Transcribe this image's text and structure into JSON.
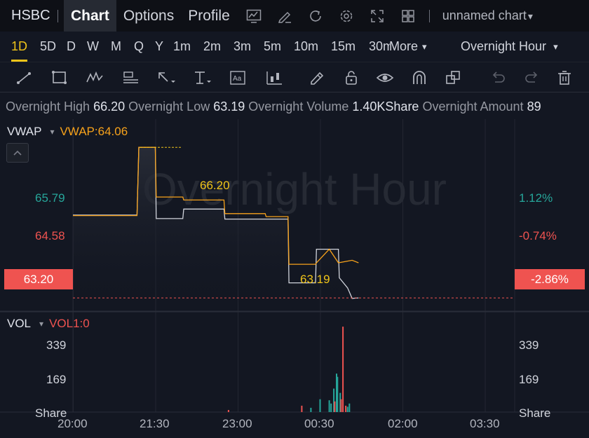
{
  "header": {
    "symbol": "HSBC",
    "tabs": [
      {
        "label": "Chart",
        "active": true
      },
      {
        "label": "Options",
        "active": false
      },
      {
        "label": "Profile",
        "active": false
      }
    ],
    "icons": [
      "chart-type-icon",
      "draw-pencil-icon",
      "refresh-icon",
      "settings-gear-icon",
      "fullscreen-icon",
      "layout-grid-icon"
    ],
    "chart_name": "unnamed chart",
    "chart_name_caret": "▾"
  },
  "timeframes": {
    "items": [
      "1D",
      "5D",
      "D",
      "W",
      "M",
      "Q",
      "Y",
      "1m",
      "2m",
      "3m",
      "5m",
      "10m",
      "15m",
      "30m"
    ],
    "more": "More",
    "more_caret": "▾",
    "active": "1D",
    "session": "Overnight Hour",
    "session_caret": "▾"
  },
  "tools": [
    "trend-line-icon",
    "rectangle-icon",
    "pattern-icon",
    "text-note-icon",
    "arrow-icon",
    "price-range-icon",
    "text-label-icon",
    "candles-icon",
    "brush-icon",
    "lock-icon",
    "eye-icon",
    "magnet-icon",
    "clone-icon",
    "undo-icon",
    "redo-icon",
    "trash-icon"
  ],
  "info": {
    "high_label": "Overnight High",
    "high_value": "66.20",
    "low_label": "Overnight Low",
    "low_value": "63.19",
    "volume_label": "Overnight Volume",
    "volume_value": "1.40KShare",
    "amount_label": "Overnight Amount",
    "amount_value": "89"
  },
  "price_pane": {
    "indicator_name": "VWAP",
    "indicator_caret": "▾",
    "indicator_value": "VWAP:64.06",
    "watermark": "Overnight Hour",
    "left_axis": [
      "65.79",
      "64.58"
    ],
    "right_axis": [
      "1.12%",
      "-0.74%"
    ],
    "current_price": "63.20",
    "current_pct": "-2.86%",
    "high_marker": "66.20",
    "low_marker": "63.19"
  },
  "volume_pane": {
    "indicator_name": "VOL",
    "indicator_caret": "▾",
    "indicator_value": "VOL1:0",
    "left_axis": [
      "339",
      "169",
      "Share"
    ],
    "right_axis": [
      "339",
      "169",
      "Share"
    ]
  },
  "time_axis": [
    "20:00",
    "21:30",
    "23:00",
    "00:30",
    "02:00",
    "03:30"
  ],
  "colors": {
    "background": "#131722",
    "up": "#26a69a",
    "down": "#ef5350",
    "vwap": "#f7a21b",
    "price_line": "#d1d4dc",
    "marker_text": "#f0c419",
    "up_axis_text": "#26a69a",
    "down_axis_text": "#ef5350"
  },
  "chart_data": {
    "type": "line",
    "price_series": {
      "x": [
        "20:00",
        "21:10",
        "21:12",
        "21:30",
        "21:31",
        "22:00",
        "22:01",
        "22:45",
        "22:46",
        "23:55",
        "23:56",
        "00:25",
        "00:26",
        "00:50",
        "00:51",
        "01:00",
        "01:05",
        "01:12"
      ],
      "price": [
        64.85,
        64.85,
        66.2,
        66.2,
        64.78,
        64.78,
        64.97,
        64.97,
        64.77,
        64.77,
        63.5,
        63.5,
        64.17,
        64.17,
        63.6,
        63.4,
        63.19,
        63.2
      ]
    },
    "vwap_series": {
      "x": [
        "20:00",
        "21:10",
        "21:12",
        "21:30",
        "21:31",
        "22:00",
        "22:01",
        "22:45",
        "22:46",
        "23:30",
        "23:31",
        "23:55",
        "23:56",
        "00:25",
        "00:26",
        "00:40",
        "00:50",
        "01:05",
        "01:12"
      ],
      "vwap": [
        64.84,
        64.84,
        66.2,
        66.2,
        65.21,
        65.21,
        65.15,
        65.15,
        64.88,
        64.88,
        64.82,
        64.82,
        63.87,
        63.87,
        63.9,
        64.17,
        63.9,
        63.95,
        63.9
      ]
    },
    "volume_bars": [
      {
        "x": "22:50",
        "volume": 10,
        "dir": "down"
      },
      {
        "x": "00:10",
        "volume": 30,
        "dir": "down"
      },
      {
        "x": "00:20",
        "volume": 20,
        "dir": "up"
      },
      {
        "x": "00:30",
        "volume": 60,
        "dir": "up"
      },
      {
        "x": "00:40",
        "volume": 55,
        "dir": "up"
      },
      {
        "x": "00:42",
        "volume": 40,
        "dir": "up"
      },
      {
        "x": "00:45",
        "volume": 110,
        "dir": "up"
      },
      {
        "x": "00:46",
        "volume": 50,
        "dir": "down"
      },
      {
        "x": "00:48",
        "volume": 180,
        "dir": "up"
      },
      {
        "x": "00:49",
        "volume": 165,
        "dir": "up"
      },
      {
        "x": "00:52",
        "volume": 90,
        "dir": "up"
      },
      {
        "x": "00:53",
        "volume": 60,
        "dir": "down"
      },
      {
        "x": "00:55",
        "volume": 400,
        "dir": "down"
      },
      {
        "x": "00:58",
        "volume": 30,
        "dir": "down"
      },
      {
        "x": "01:00",
        "volume": 25,
        "dir": "up"
      },
      {
        "x": "01:02",
        "volume": 40,
        "dir": "up"
      }
    ],
    "xlabel": "",
    "ylabel": "",
    "ylim_price": [
      62.95,
      66.65
    ],
    "ylim_volume": [
      0,
      420
    ]
  }
}
